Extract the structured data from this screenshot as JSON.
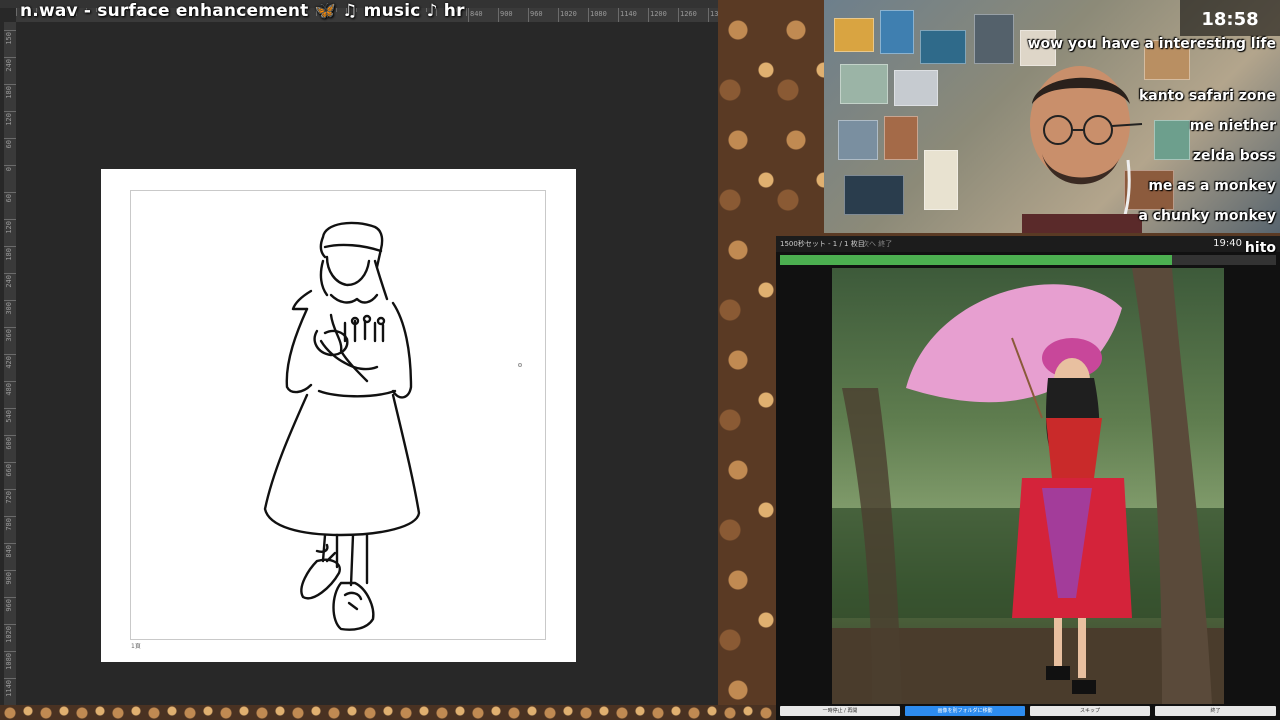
{
  "stream": {
    "title": "n.wav - surface enhancement 🦋            ♫ music ♪ hr"
  },
  "ruler": {
    "h_labels": [
      "840",
      "900",
      "960",
      "1020",
      "1080",
      "1140",
      "1200",
      "1260",
      "1320",
      "1380",
      "144"
    ],
    "v_labels": [
      "150",
      "240",
      "180",
      "120",
      "60",
      "0",
      "60",
      "120",
      "180",
      "240",
      "300",
      "360",
      "420",
      "480",
      "540",
      "600",
      "660",
      "720",
      "780",
      "840",
      "900",
      "960",
      "1020",
      "1080",
      "1140"
    ]
  },
  "canvas": {
    "frame_label": "1頁"
  },
  "webcam": {
    "clock": "18:58"
  },
  "chat": {
    "messages": [
      "wow you have a interesting life",
      "kanto safari zone",
      "me niether",
      "zelda boss",
      "me as a monkey",
      "a chunky monkey"
    ],
    "trailing_name": "hito"
  },
  "viewer": {
    "session_label": "1500秒セット - 1 / 1 枚目",
    "next_label": "次へ 終了",
    "timer": "19:40",
    "progress": 0.79,
    "buttons": [
      "一時停止 / 再開",
      "画像を別フォルダに移動",
      "スキップ",
      "終了"
    ]
  },
  "colors": {
    "progress": "#4caf50",
    "accent_button": "#2d8cf0"
  }
}
